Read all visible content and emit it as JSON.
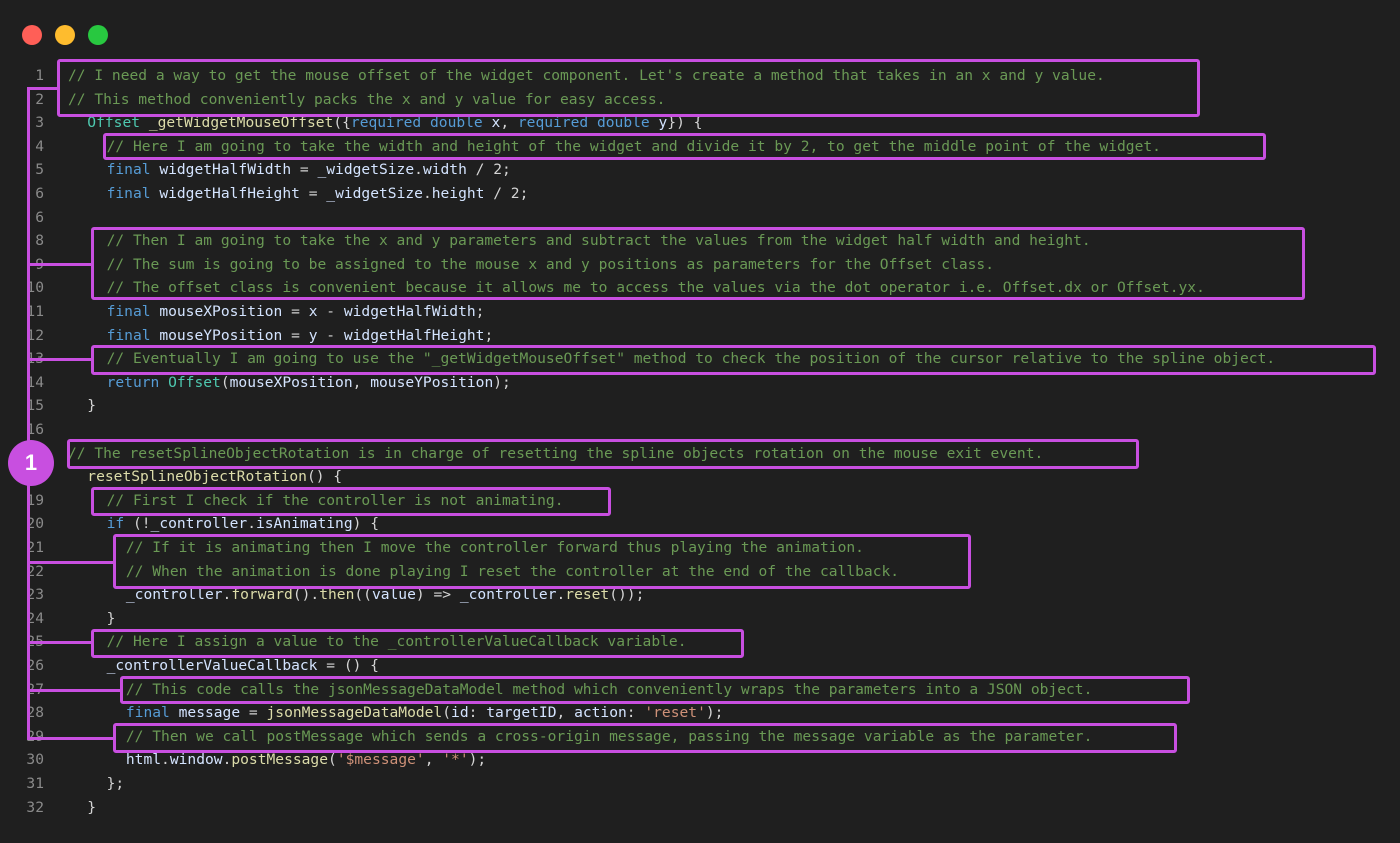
{
  "badge": "1",
  "lines": [
    {
      "n": "1",
      "indent": 0,
      "tokens": [
        {
          "c": "cm",
          "t": "// I need a way to get the mouse offset of the widget component. Let's create a method that takes in an x and y value."
        }
      ]
    },
    {
      "n": "2",
      "indent": 0,
      "tokens": [
        {
          "c": "cm",
          "t": "// This method conveniently packs the x and y value for easy access."
        }
      ]
    },
    {
      "n": "3",
      "indent": 1,
      "tokens": [
        {
          "c": "ty",
          "t": "Offset"
        },
        {
          "c": "tx",
          "t": " "
        },
        {
          "c": "fn",
          "t": "_getWidgetMouseOffset"
        },
        {
          "c": "tx",
          "t": "({"
        },
        {
          "c": "kw",
          "t": "required"
        },
        {
          "c": "tx",
          "t": " "
        },
        {
          "c": "kw",
          "t": "double"
        },
        {
          "c": "tx",
          "t": " "
        },
        {
          "c": "vr",
          "t": "x"
        },
        {
          "c": "tx",
          "t": ", "
        },
        {
          "c": "kw",
          "t": "required"
        },
        {
          "c": "tx",
          "t": " "
        },
        {
          "c": "kw",
          "t": "double"
        },
        {
          "c": "tx",
          "t": " "
        },
        {
          "c": "vr",
          "t": "y"
        },
        {
          "c": "tx",
          "t": "}) {"
        }
      ]
    },
    {
      "n": "4",
      "indent": 2,
      "tokens": [
        {
          "c": "cm",
          "t": "// Here I am going to take the width and height of the widget and divide it by 2, to get the middle point of the widget."
        }
      ]
    },
    {
      "n": "5",
      "indent": 2,
      "tokens": [
        {
          "c": "kw",
          "t": "final"
        },
        {
          "c": "tx",
          "t": " "
        },
        {
          "c": "vr",
          "t": "widgetHalfWidth"
        },
        {
          "c": "tx",
          "t": " = "
        },
        {
          "c": "vr",
          "t": "_widgetSize"
        },
        {
          "c": "tx",
          "t": "."
        },
        {
          "c": "vr",
          "t": "width"
        },
        {
          "c": "tx",
          "t": " / 2;"
        }
      ]
    },
    {
      "n": "6",
      "indent": 2,
      "tokens": [
        {
          "c": "kw",
          "t": "final"
        },
        {
          "c": "tx",
          "t": " "
        },
        {
          "c": "vr",
          "t": "widgetHalfHeight"
        },
        {
          "c": "tx",
          "t": " = "
        },
        {
          "c": "vr",
          "t": "_widgetSize"
        },
        {
          "c": "tx",
          "t": "."
        },
        {
          "c": "vr",
          "t": "height"
        },
        {
          "c": "tx",
          "t": " / 2;"
        }
      ]
    },
    {
      "n": "6",
      "indent": 0,
      "tokens": []
    },
    {
      "n": "8",
      "indent": 2,
      "tokens": [
        {
          "c": "cm",
          "t": "// Then I am going to take the x and y parameters and subtract the values from the widget half width and height."
        }
      ]
    },
    {
      "n": "9",
      "indent": 2,
      "tokens": [
        {
          "c": "cm",
          "t": "// The sum is going to be assigned to the mouse x and y positions as parameters for the Offset class."
        }
      ]
    },
    {
      "n": "10",
      "indent": 2,
      "tokens": [
        {
          "c": "cm",
          "t": "// The offset class is convenient because it allows me to access the values via the dot operator i.e. Offset.dx or Offset.yx."
        }
      ]
    },
    {
      "n": "11",
      "indent": 2,
      "tokens": [
        {
          "c": "kw",
          "t": "final"
        },
        {
          "c": "tx",
          "t": " "
        },
        {
          "c": "vr",
          "t": "mouseXPosition"
        },
        {
          "c": "tx",
          "t": " = "
        },
        {
          "c": "vr",
          "t": "x"
        },
        {
          "c": "tx",
          "t": " - "
        },
        {
          "c": "vr",
          "t": "widgetHalfWidth"
        },
        {
          "c": "tx",
          "t": ";"
        }
      ]
    },
    {
      "n": "12",
      "indent": 2,
      "tokens": [
        {
          "c": "kw",
          "t": "final"
        },
        {
          "c": "tx",
          "t": " "
        },
        {
          "c": "vr",
          "t": "mouseYPosition"
        },
        {
          "c": "tx",
          "t": " = "
        },
        {
          "c": "vr",
          "t": "y"
        },
        {
          "c": "tx",
          "t": " - "
        },
        {
          "c": "vr",
          "t": "widgetHalfHeight"
        },
        {
          "c": "tx",
          "t": ";"
        }
      ]
    },
    {
      "n": "13",
      "indent": 2,
      "tokens": [
        {
          "c": "cm",
          "t": "// Eventually I am going to use the \"_getWidgetMouseOffset\" method to check the position of the cursor relative to the spline object."
        }
      ]
    },
    {
      "n": "14",
      "indent": 2,
      "tokens": [
        {
          "c": "kw",
          "t": "return"
        },
        {
          "c": "tx",
          "t": " "
        },
        {
          "c": "ty",
          "t": "Offset"
        },
        {
          "c": "tx",
          "t": "("
        },
        {
          "c": "vr",
          "t": "mouseXPosition"
        },
        {
          "c": "tx",
          "t": ", "
        },
        {
          "c": "vr",
          "t": "mouseYPosition"
        },
        {
          "c": "tx",
          "t": ");"
        }
      ]
    },
    {
      "n": "15",
      "indent": 1,
      "tokens": [
        {
          "c": "tx",
          "t": "}"
        }
      ]
    },
    {
      "n": "16",
      "indent": 0,
      "tokens": []
    },
    {
      "n": "17",
      "indent": 0,
      "tokens": [
        {
          "c": "cm",
          "t": "// The resetSplineObjectRotation is in charge of resetting the spline objects rotation on the mouse exit event."
        }
      ]
    },
    {
      "n": "18",
      "indent": 1,
      "tokens": [
        {
          "c": "fn",
          "t": "resetSplineObjectRotation"
        },
        {
          "c": "tx",
          "t": "() {"
        }
      ]
    },
    {
      "n": "19",
      "indent": 2,
      "tokens": [
        {
          "c": "cm",
          "t": "// First I check if the controller is not animating."
        }
      ]
    },
    {
      "n": "20",
      "indent": 2,
      "tokens": [
        {
          "c": "kw",
          "t": "if"
        },
        {
          "c": "tx",
          "t": " (!"
        },
        {
          "c": "vr",
          "t": "_controller"
        },
        {
          "c": "tx",
          "t": "."
        },
        {
          "c": "vr",
          "t": "isAnimating"
        },
        {
          "c": "tx",
          "t": ") {"
        }
      ]
    },
    {
      "n": "21",
      "indent": 3,
      "tokens": [
        {
          "c": "cm",
          "t": "// If it is animating then I move the controller forward thus playing the animation."
        }
      ]
    },
    {
      "n": "22",
      "indent": 3,
      "tokens": [
        {
          "c": "cm",
          "t": "// When the animation is done playing I reset the controller at the end of the callback."
        }
      ]
    },
    {
      "n": "23",
      "indent": 3,
      "tokens": [
        {
          "c": "vr",
          "t": "_controller"
        },
        {
          "c": "tx",
          "t": "."
        },
        {
          "c": "fn",
          "t": "forward"
        },
        {
          "c": "tx",
          "t": "()."
        },
        {
          "c": "fn",
          "t": "then"
        },
        {
          "c": "tx",
          "t": "(("
        },
        {
          "c": "vr",
          "t": "value"
        },
        {
          "c": "tx",
          "t": ") => "
        },
        {
          "c": "vr",
          "t": "_controller"
        },
        {
          "c": "tx",
          "t": "."
        },
        {
          "c": "fn",
          "t": "reset"
        },
        {
          "c": "tx",
          "t": "());"
        }
      ]
    },
    {
      "n": "24",
      "indent": 2,
      "tokens": [
        {
          "c": "tx",
          "t": "}"
        }
      ]
    },
    {
      "n": "25",
      "indent": 2,
      "tokens": [
        {
          "c": "cm",
          "t": "// Here I assign a value to the _controllerValueCallback variable."
        }
      ]
    },
    {
      "n": "26",
      "indent": 2,
      "tokens": [
        {
          "c": "vr",
          "t": "_controllerValueCallback"
        },
        {
          "c": "tx",
          "t": " = () {"
        }
      ]
    },
    {
      "n": "27",
      "indent": 3,
      "tokens": [
        {
          "c": "cm",
          "t": "// This code calls the jsonMessageDataModel method which conveniently wraps the parameters into a JSON object."
        }
      ]
    },
    {
      "n": "28",
      "indent": 3,
      "tokens": [
        {
          "c": "kw",
          "t": "final"
        },
        {
          "c": "tx",
          "t": " "
        },
        {
          "c": "vr",
          "t": "message"
        },
        {
          "c": "tx",
          "t": " = "
        },
        {
          "c": "fn",
          "t": "jsonMessageDataModel"
        },
        {
          "c": "tx",
          "t": "("
        },
        {
          "c": "vr",
          "t": "id"
        },
        {
          "c": "tx",
          "t": ": "
        },
        {
          "c": "vr",
          "t": "targetID"
        },
        {
          "c": "tx",
          "t": ", "
        },
        {
          "c": "vr",
          "t": "action"
        },
        {
          "c": "tx",
          "t": ": "
        },
        {
          "c": "st",
          "t": "'reset'"
        },
        {
          "c": "tx",
          "t": ");"
        }
      ]
    },
    {
      "n": "29",
      "indent": 3,
      "tokens": [
        {
          "c": "cm",
          "t": "// Then we call postMessage which sends a cross-origin message, passing the message variable as the parameter."
        }
      ]
    },
    {
      "n": "30",
      "indent": 3,
      "tokens": [
        {
          "c": "vr",
          "t": "html"
        },
        {
          "c": "tx",
          "t": "."
        },
        {
          "c": "vr",
          "t": "window"
        },
        {
          "c": "tx",
          "t": "."
        },
        {
          "c": "fn",
          "t": "postMessage"
        },
        {
          "c": "tx",
          "t": "("
        },
        {
          "c": "st",
          "t": "'$message'"
        },
        {
          "c": "tx",
          "t": ", "
        },
        {
          "c": "st",
          "t": "'*'"
        },
        {
          "c": "tx",
          "t": ");"
        }
      ]
    },
    {
      "n": "31",
      "indent": 2,
      "tokens": [
        {
          "c": "tx",
          "t": "};"
        }
      ]
    },
    {
      "n": "32",
      "indent": 1,
      "tokens": [
        {
          "c": "tx",
          "t": "}"
        }
      ]
    }
  ]
}
